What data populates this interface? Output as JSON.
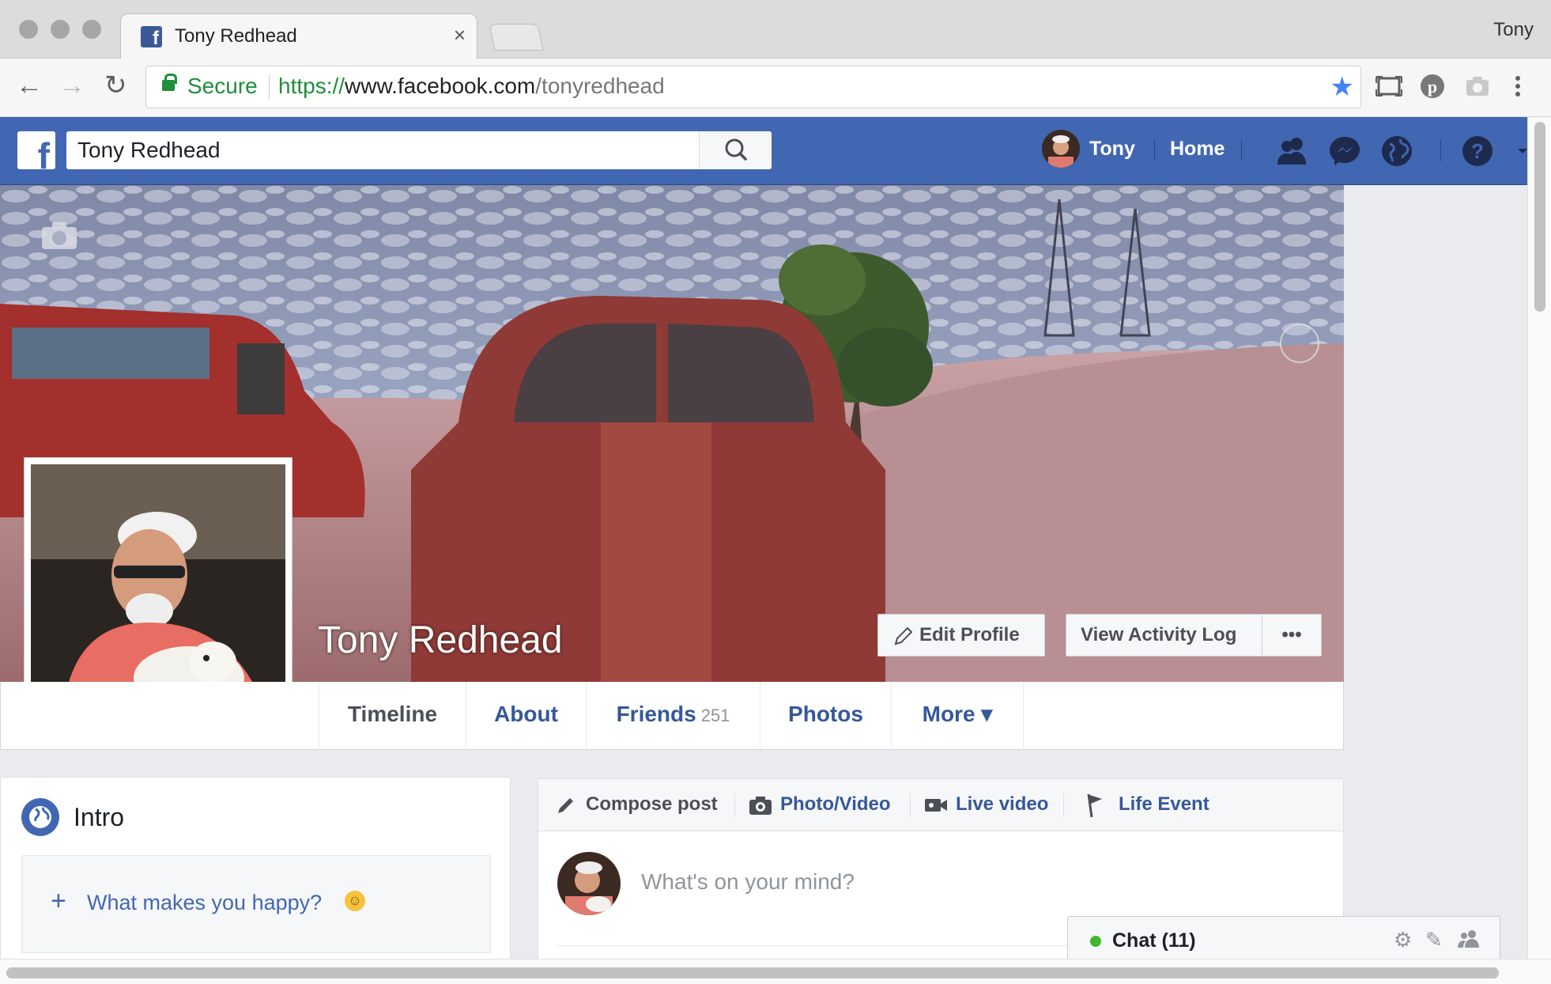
{
  "browser": {
    "tab_title": "Tony Redhead",
    "tab_close": "×",
    "profile_name": "Tony",
    "secure_label": "Secure",
    "url_scheme": "https://",
    "url_host": "www.facebook.com",
    "url_path": "/tonyredhead"
  },
  "fb": {
    "logo": "f",
    "search_value": "Tony Redhead",
    "user_name": "Tony",
    "home_label": "Home",
    "colors": {
      "brand": "#4267b2",
      "link": "#365899"
    }
  },
  "profile": {
    "name": "Tony Redhead",
    "edit_profile": "Edit Profile",
    "activity_log": "View Activity Log",
    "more_dots": "•••",
    "tabs": [
      {
        "label": "Timeline"
      },
      {
        "label": "About"
      },
      {
        "label": "Friends",
        "count": "251"
      },
      {
        "label": "Photos"
      },
      {
        "label": "More ▾"
      }
    ]
  },
  "intro": {
    "title": "Intro",
    "prompt": "What makes you happy?",
    "plus": "+",
    "emoji": "☺"
  },
  "composer": {
    "tabs": [
      {
        "label": "Compose post"
      },
      {
        "label": "Photo/Video"
      },
      {
        "label": "Live video"
      },
      {
        "label": "Life Event"
      }
    ],
    "placeholder": "What's on your mind?"
  },
  "chat": {
    "label": "Chat (11)"
  }
}
